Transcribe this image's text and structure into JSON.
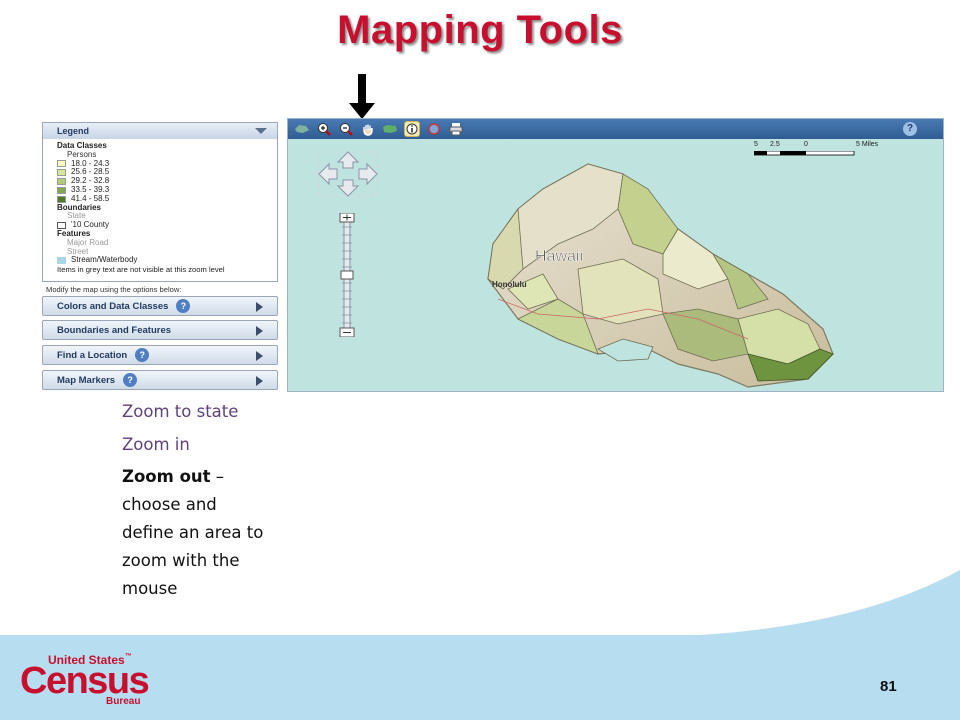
{
  "slide": {
    "title": "Mapping Tools",
    "page_number": "81"
  },
  "legend": {
    "title": "Legend",
    "data_classes_label": "Data Classes",
    "measure_label": "Persons",
    "classes": [
      {
        "range": "18.0 - 24.3",
        "color": "#fbf9c2"
      },
      {
        "range": "25.6 - 28.5",
        "color": "#d9e6a0"
      },
      {
        "range": "29.2 - 32.8",
        "color": "#b4cc7a"
      },
      {
        "range": "33.5 - 39.3",
        "color": "#83a84f"
      },
      {
        "range": "41.4 - 58.5",
        "color": "#4f7a2a"
      }
    ],
    "boundaries_label": "Boundaries",
    "state_label": "State",
    "county_label": "'10 County",
    "features_label": "Features",
    "major_road_label": "Major Road",
    "street_label": "Street",
    "water_label": "Stream/Waterbody",
    "water_color": "#a9d6e6",
    "note": "Items in grey text are not visible at this zoom level"
  },
  "modify_note": "Modify the map using the options below:",
  "options": [
    {
      "label": "Colors and Data Classes",
      "help": "?"
    },
    {
      "label": "Boundaries and Features",
      "help": ""
    },
    {
      "label": "Find a Location",
      "help": "?"
    },
    {
      "label": "Map Markers",
      "help": "?"
    }
  ],
  "map": {
    "place_label": "Hawaii",
    "city_label": "Honolulu",
    "help_symbol": "?",
    "scale_labels": [
      "5",
      "2.5",
      "0",
      "5 Miles"
    ],
    "toolbar_icons": [
      "zoom-to-state-icon",
      "zoom-in-icon",
      "zoom-out-icon",
      "pan-hand-icon",
      "full-extent-icon",
      "identify-icon",
      "clear-icon",
      "print-icon"
    ]
  },
  "captions": {
    "zoom_state": "Zoom to state",
    "zoom_in": "Zoom in",
    "zoom_out_bold": "Zoom out",
    "zoom_out_rest": " – choose and define an area to zoom with the mouse"
  },
  "branding": {
    "logo_line1": "United States",
    "logo_tm": "™",
    "logo_line2": "Census",
    "logo_line3": "Bureau",
    "logo_color": "#c8102e",
    "band_color": "#b7ddf1",
    "title_color": "#c8102e"
  }
}
